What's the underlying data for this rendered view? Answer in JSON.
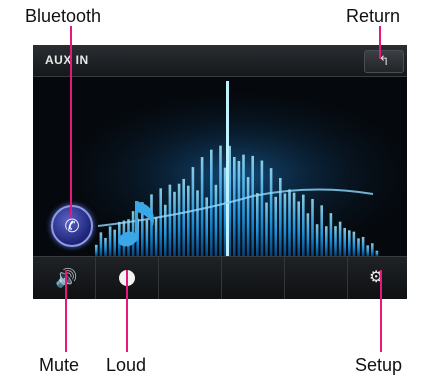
{
  "callouts": {
    "bluetooth": "Bluetooth",
    "return": "Return",
    "mute": "Mute",
    "loud": "Loud",
    "setup": "Setup"
  },
  "screen": {
    "source_label": "AUX IN",
    "return_icon": "return-arrow-icon",
    "bluetooth_icon": "phone-icon",
    "bottom_icons": [
      "speaker-icon",
      "loud-icon",
      "gear-icon"
    ]
  },
  "colors": {
    "callout_line": "#e5197b",
    "visualizer": "#1ea8ff"
  }
}
